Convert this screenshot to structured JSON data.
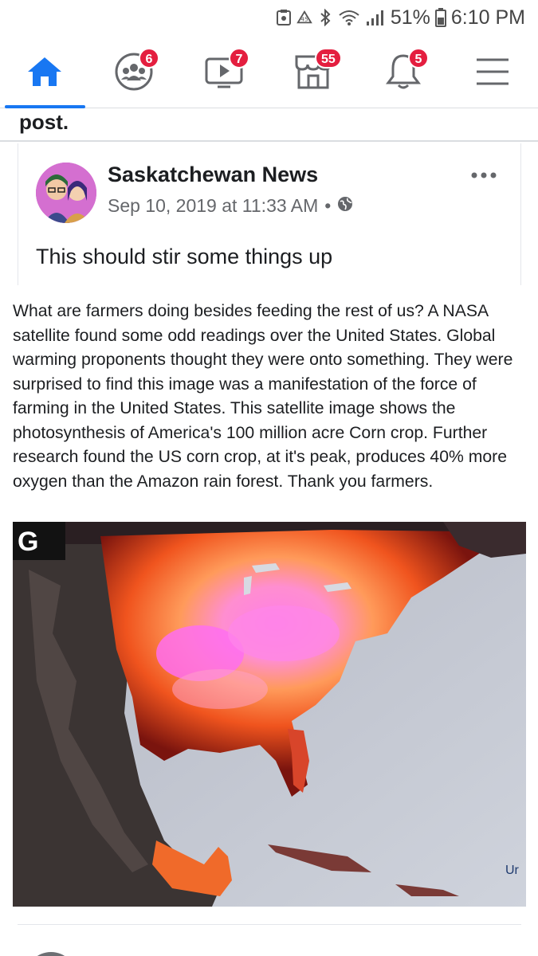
{
  "status_bar": {
    "battery_percent": "51%",
    "time": "6:10 PM"
  },
  "nav": {
    "tabs": [
      {
        "name": "home",
        "badge": null,
        "active": true
      },
      {
        "name": "groups",
        "badge": "6"
      },
      {
        "name": "watch",
        "badge": "7"
      },
      {
        "name": "marketplace",
        "badge": "55"
      },
      {
        "name": "notifications",
        "badge": "5"
      },
      {
        "name": "menu",
        "badge": null
      }
    ],
    "accent_color": "#1877f2",
    "badge_color": "#e41e3f"
  },
  "top_fragment": {
    "text": "post."
  },
  "shared_post": {
    "page_name": "Saskatchewan News",
    "timestamp": "Sep 10, 2019 at 11:33 AM",
    "separator": "•",
    "privacy_icon": "globe-icon",
    "more_icon": "more-options-icon",
    "text": "This should stir some things up"
  },
  "post_body": "What are farmers doing besides feeding the rest of us? A NASA satellite found some odd readings over the United States. Global warming proponents thought they were onto something. They were surprised to find this image was a manifestation of the force of farming in the United States. This satellite image shows the photosynthesis of America's 100 million acre Corn crop. Further research found the US corn crop, at it's peak, produces 40% more oxygen than the Amazon rain forest. Thank you farmers.",
  "image": {
    "corner_label": "G",
    "edge_text": "Ur"
  }
}
